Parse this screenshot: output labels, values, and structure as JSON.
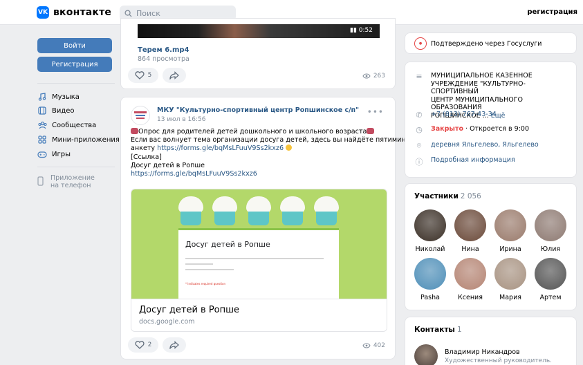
{
  "header": {
    "logo_text": "вконтакте",
    "logo_mark": "VK",
    "search_placeholder": "Поиск",
    "register_link": "регистрация"
  },
  "sidebar": {
    "login_button": "Войти",
    "register_button": "Регистрация",
    "items": [
      {
        "label": "Музыка",
        "icon": "music-icon"
      },
      {
        "label": "Видео",
        "icon": "video-icon"
      },
      {
        "label": "Сообщества",
        "icon": "communities-icon"
      },
      {
        "label": "Мини-приложения",
        "icon": "apps-icon"
      },
      {
        "label": "Игры",
        "icon": "games-icon"
      }
    ],
    "app_line1": "Приложение",
    "app_line2": "на телефон"
  },
  "feed": {
    "video_post": {
      "duration": "0:52",
      "title": "Терем 6.mp4",
      "views_text": "864 просмотра",
      "likes": "5",
      "views": "263"
    },
    "post": {
      "author": "МКУ \"Культурно-спортивный центр Ропшинское с/п\"",
      "date": "13 июл в 16:56",
      "line1": "Опрос для родителей детей дошкольного и школьного возраста",
      "line2": "Если вас волнует тема организации досуга детей, здесь вы найдёте пятиминутную",
      "line3_text": "анкету ",
      "line3_link": "https://forms.gle/bqMsLFuuV9Ss2kxz6",
      "line4": "[Ссылка]",
      "line5": "Досуг детей в Ропше",
      "line6_link": "https://forms.gle/bqMsLFuuV9Ss2kxz6",
      "form_title": "Досуг детей в Ропше",
      "form_required": "* Indicates required question",
      "preview_title": "Досуг детей в Ропше",
      "preview_url": "docs.google.com",
      "likes": "2",
      "views": "402"
    }
  },
  "right": {
    "gosuslugi_text": "Подтверждено через Госуслуги",
    "org_name_1": "МУНИЦИПАЛЬНОЕ КАЗЕННОЕ",
    "org_name_2": "УЧРЕЖДЕНИЕ \"КУЛЬТУРНО-СПОРТИВНЫЙ",
    "org_name_3": "ЦЕНТР МУНИЦИПАЛЬНОГО ОБРАЗОВАНИЯ",
    "org_name_4": "РОПШИНСКОЕ ...",
    "org_more": "Ещё",
    "phone": "+7 (813) 767-43-34",
    "closed": "Закрыто",
    "opens": "· Откроется в 9:00",
    "address": "деревня Яльгелево, Яльгелево",
    "details": "Подробная информация",
    "members_title": "Участники",
    "members_count": "2 056",
    "members": [
      {
        "name": "Николай",
        "color": "#3b3027"
      },
      {
        "name": "Нина",
        "color": "#6b4a3a"
      },
      {
        "name": "Ирина",
        "color": "#9a7b6c"
      },
      {
        "name": "Юлия",
        "color": "#8e7a72"
      },
      {
        "name": "Pasha",
        "color": "#4f8fb8"
      },
      {
        "name": "Ксения",
        "color": "#b58574"
      },
      {
        "name": "Мария",
        "color": "#a89382"
      },
      {
        "name": "Артем",
        "color": "#555555"
      }
    ],
    "contacts_title": "Контакты",
    "contacts_count": "1",
    "contact_name": "Владимир Никандров",
    "contact_role": "Художественный руководитель."
  }
}
